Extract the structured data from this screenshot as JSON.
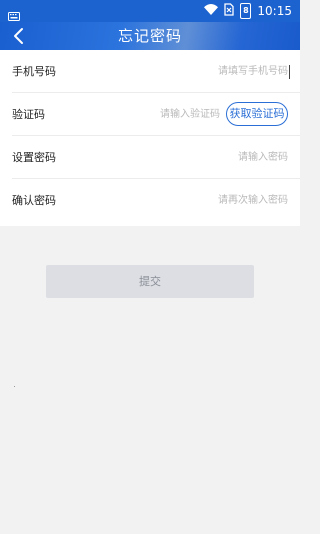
{
  "status_bar": {
    "time": "10:15",
    "battery_level": "8",
    "icons": [
      "keyboard-icon",
      "wifi-icon",
      "no-sim-icon",
      "battery-icon"
    ]
  },
  "header": {
    "title": "忘记密码",
    "back_icon": "chevron-left-icon"
  },
  "form": {
    "phone": {
      "label": "手机号码",
      "placeholder": "请填写手机号码"
    },
    "code": {
      "label": "验证码",
      "placeholder": "请输入验证码",
      "button": "获取验证码"
    },
    "password": {
      "label": "设置密码",
      "placeholder": "请输入密码"
    },
    "confirm": {
      "label": "确认密码",
      "placeholder": "请再次输入密码"
    }
  },
  "submit_label": "提交",
  "colors": {
    "primary": "#1d63cf",
    "button_disabled_bg": "#dcdee3",
    "page_bg": "#f2f2f2"
  }
}
